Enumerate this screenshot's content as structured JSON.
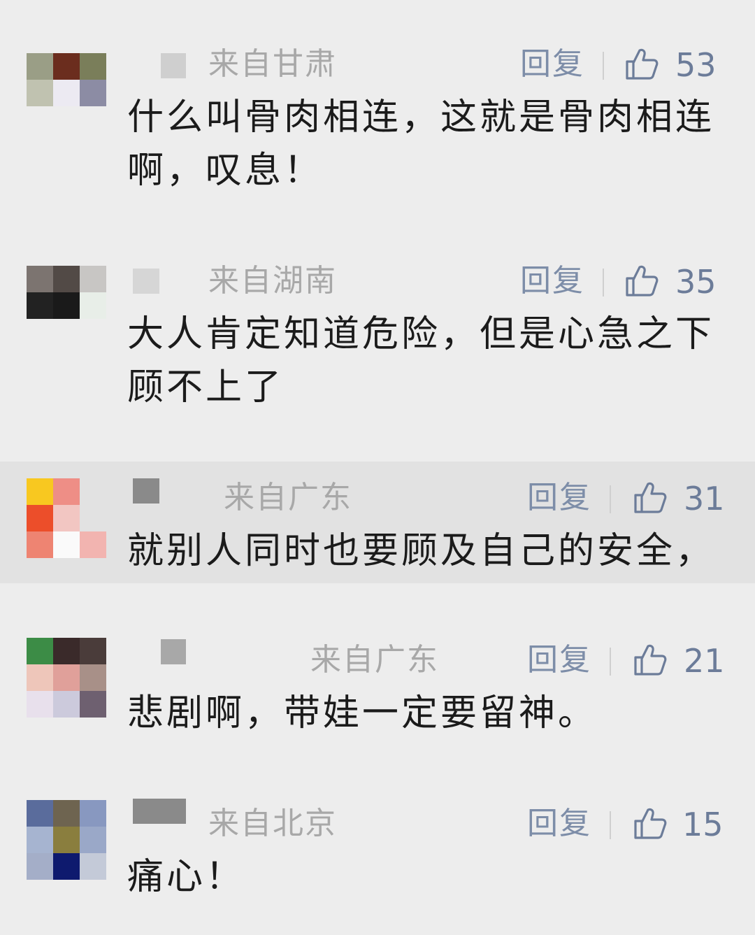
{
  "comments": [
    {
      "region": "来自甘肃",
      "reply_label": "回复",
      "like_count": "53",
      "text": "什么叫骨肉相连，这就是骨肉相连啊，叹息！",
      "avatar_colors": [
        "#9a9e86",
        "#6b2d1e",
        "#7a7e5a",
        "#c0c2b0",
        "#eceaf2",
        "#8c8ca4"
      ]
    },
    {
      "region": "来自湖南",
      "reply_label": "回复",
      "like_count": "35",
      "text": "大人肯定知道危险，但是心急之下顾不上了",
      "avatar_colors": [
        "#7c7470",
        "#524a46",
        "#c8c6c4",
        "#222222",
        "#1a1a1a",
        "#e8eee8"
      ]
    },
    {
      "region": "来自广东",
      "reply_label": "回复",
      "like_count": "31",
      "text": "就别人同时也要顾及自己的安全，",
      "avatar_colors": [
        "#f8c820",
        "#ee8e86",
        "#e2e2e2",
        "#ec4e2a",
        "#f2c6c2",
        "#e2e2e2",
        "#ee8472",
        "#fafafa",
        "#f2b4b0"
      ]
    },
    {
      "region": "来自广东",
      "reply_label": "回复",
      "like_count": "21",
      "text": "悲剧啊，带娃一定要留神。",
      "avatar_colors": [
        "#3c8c46",
        "#3a2a2a",
        "#4a3c3a",
        "#eec6ba",
        "#e0a09a",
        "#a89088",
        "#e8e0ec",
        "#cccadc",
        "#6e6070"
      ]
    },
    {
      "region": "来自北京",
      "reply_label": "回复",
      "like_count": "15",
      "text": "痛心！",
      "avatar_colors": [
        "#5a6c9c",
        "#6e6450",
        "#8898c0",
        "#a6b4d0",
        "#8a7e3e",
        "#9aa8c8",
        "#a4aec8",
        "#0e1a6e",
        "#c4cad8"
      ]
    }
  ],
  "colors": {
    "background": "#ededed",
    "highlight_row": "#e2e2e2",
    "region_text": "#a8a8a8",
    "reply_text": "#7d8da8",
    "like_text": "#6c7c99",
    "body_text": "#1b1b1b"
  },
  "icons": {
    "like": "thumbs-up-icon"
  }
}
